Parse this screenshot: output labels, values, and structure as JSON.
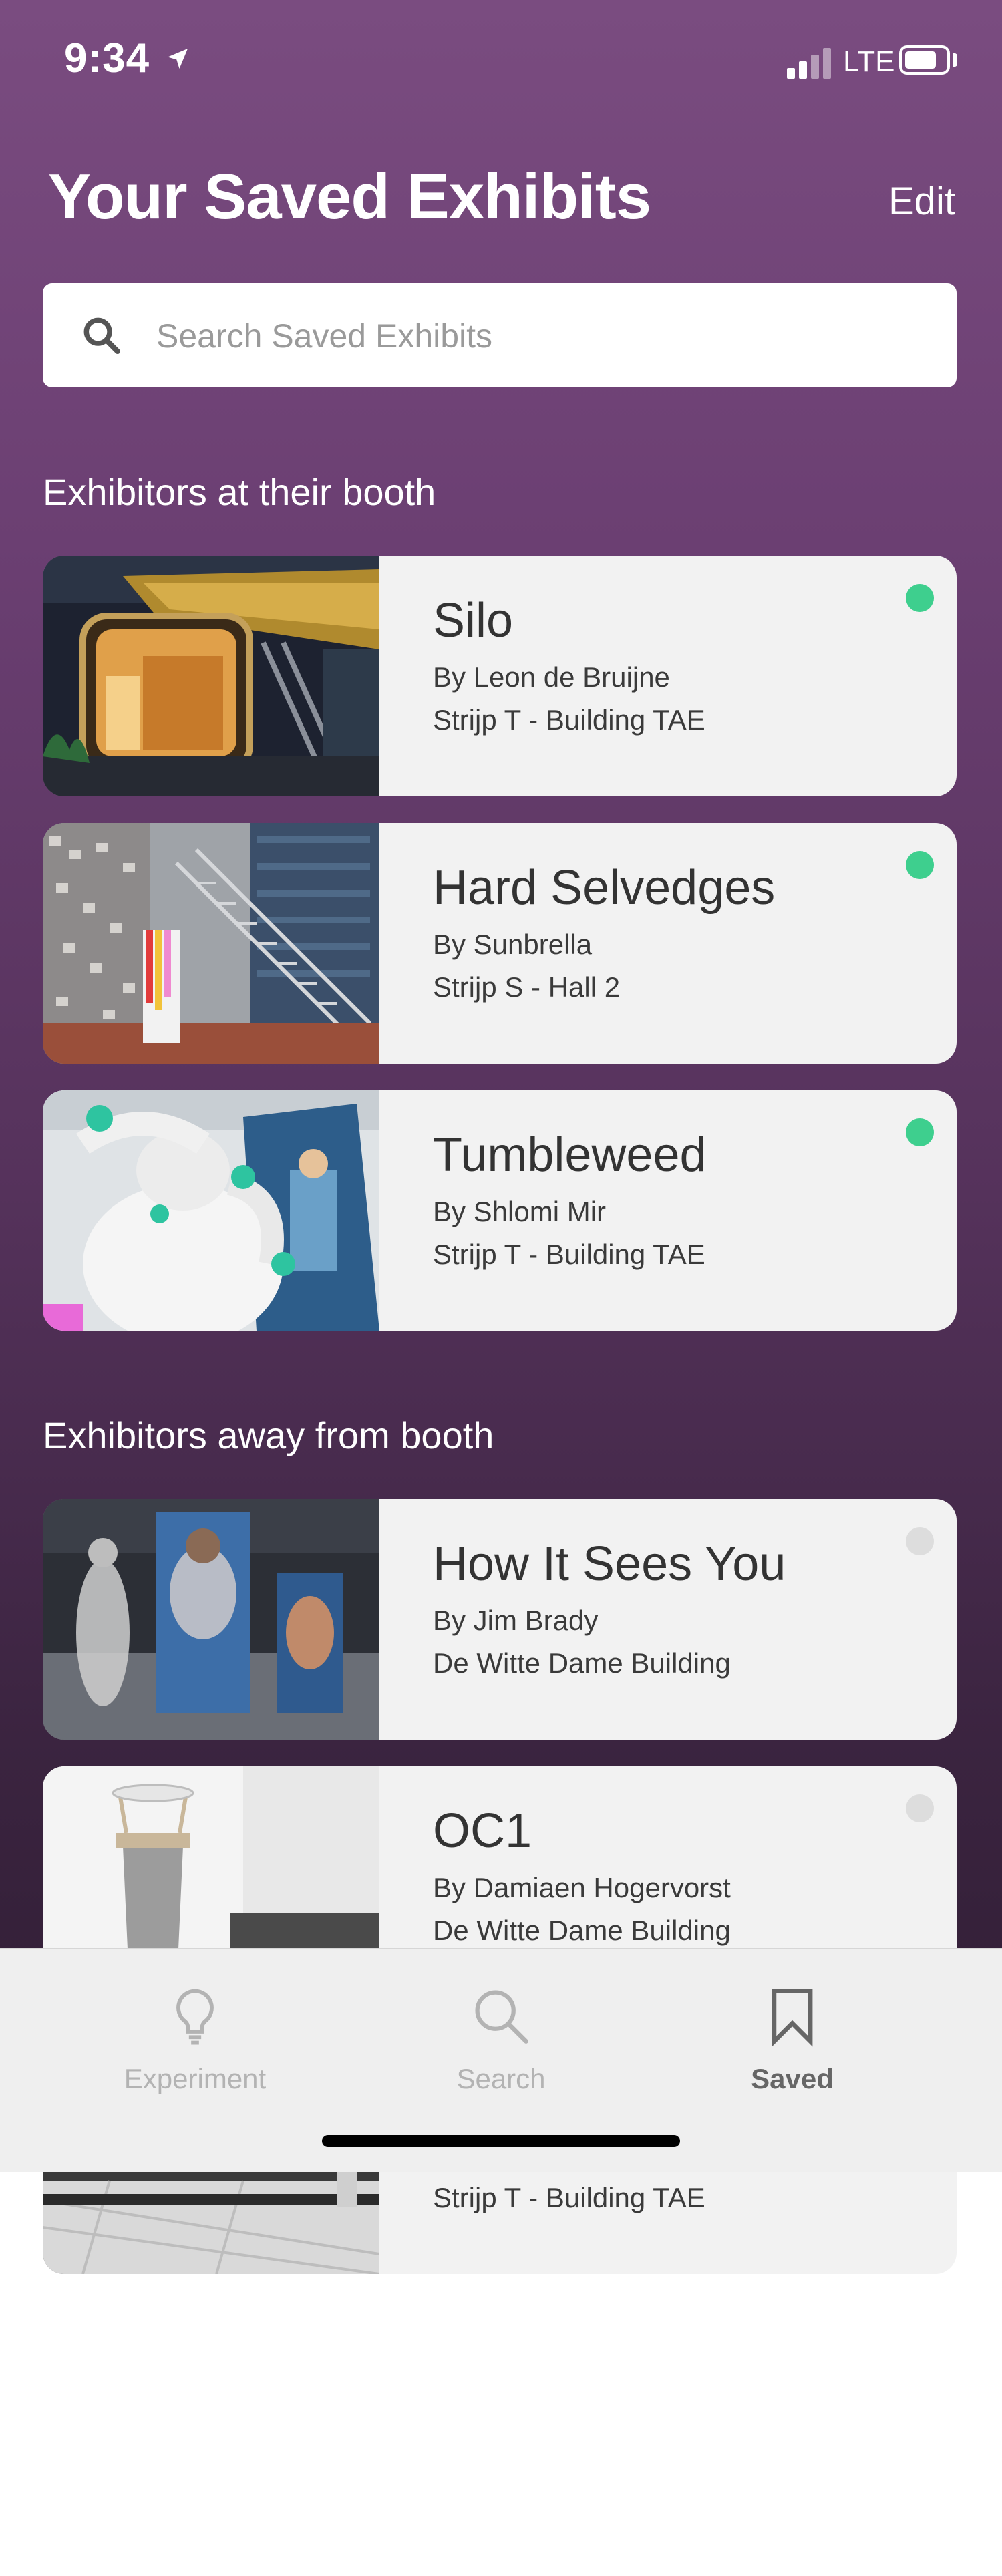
{
  "status_bar": {
    "time": "9:34",
    "network": "LTE"
  },
  "header": {
    "title": "Your Saved Exhibits",
    "edit_label": "Edit"
  },
  "search": {
    "placeholder": "Search Saved Exhibits",
    "value": ""
  },
  "sections": [
    {
      "heading": "Exhibitors at their booth"
    },
    {
      "heading": "Exhibitors away from booth"
    }
  ],
  "exhibits": [
    {
      "title": "Silo",
      "by": "By Leon de Bruijne",
      "location": "Strijp T - Building TAE",
      "at_booth": true
    },
    {
      "title": "Hard Selvedges",
      "by": "By Sunbrella",
      "location": "Strijp S - Hall 2",
      "at_booth": true
    },
    {
      "title": "Tumbleweed",
      "by": "By Shlomi Mir",
      "location": "Strijp T - Building TAE",
      "at_booth": true
    },
    {
      "title": "How It Sees You",
      "by": "By Jim Brady",
      "location": "De Witte Dame Building",
      "at_booth": false
    },
    {
      "title": "OC1",
      "by": "By Damiaen Hogervorst",
      "location": "De Witte Dame Building",
      "at_booth": false
    },
    {
      "title": "",
      "by": "",
      "location": "Strijp T - Building TAE",
      "at_booth": false
    }
  ],
  "status_colors": {
    "at_booth": "#3ecf8e",
    "away": "#dddddd"
  },
  "tab_bar": {
    "tabs": [
      {
        "label": "Experiment",
        "icon": "lightbulb-icon",
        "active": false
      },
      {
        "label": "Search",
        "icon": "search-icon",
        "active": false
      },
      {
        "label": "Saved",
        "icon": "bookmark-icon",
        "active": true
      }
    ]
  }
}
